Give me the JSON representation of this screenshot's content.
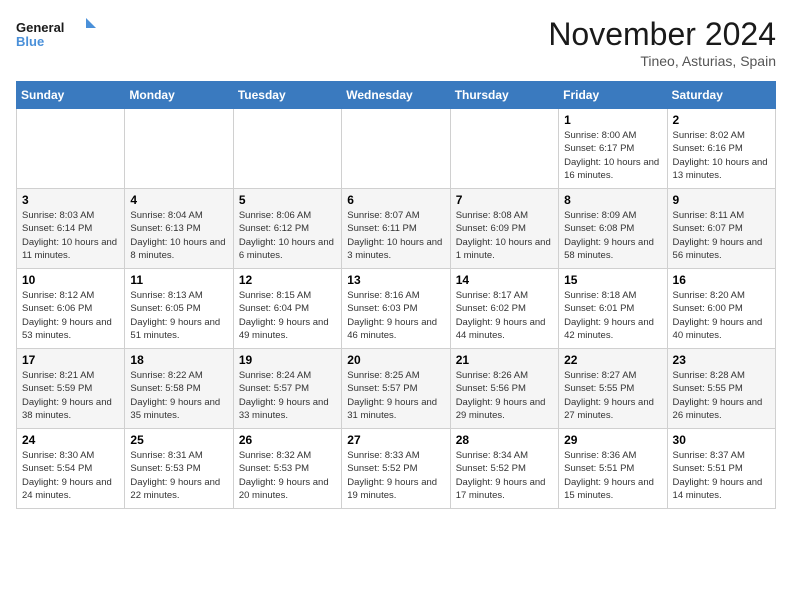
{
  "header": {
    "logo_general": "General",
    "logo_blue": "Blue",
    "month_title": "November 2024",
    "location": "Tineo, Asturias, Spain"
  },
  "days_of_week": [
    "Sunday",
    "Monday",
    "Tuesday",
    "Wednesday",
    "Thursday",
    "Friday",
    "Saturday"
  ],
  "weeks": [
    [
      {
        "day": "",
        "info": ""
      },
      {
        "day": "",
        "info": ""
      },
      {
        "day": "",
        "info": ""
      },
      {
        "day": "",
        "info": ""
      },
      {
        "day": "",
        "info": ""
      },
      {
        "day": "1",
        "info": "Sunrise: 8:00 AM\nSunset: 6:17 PM\nDaylight: 10 hours and 16 minutes."
      },
      {
        "day": "2",
        "info": "Sunrise: 8:02 AM\nSunset: 6:16 PM\nDaylight: 10 hours and 13 minutes."
      }
    ],
    [
      {
        "day": "3",
        "info": "Sunrise: 8:03 AM\nSunset: 6:14 PM\nDaylight: 10 hours and 11 minutes."
      },
      {
        "day": "4",
        "info": "Sunrise: 8:04 AM\nSunset: 6:13 PM\nDaylight: 10 hours and 8 minutes."
      },
      {
        "day": "5",
        "info": "Sunrise: 8:06 AM\nSunset: 6:12 PM\nDaylight: 10 hours and 6 minutes."
      },
      {
        "day": "6",
        "info": "Sunrise: 8:07 AM\nSunset: 6:11 PM\nDaylight: 10 hours and 3 minutes."
      },
      {
        "day": "7",
        "info": "Sunrise: 8:08 AM\nSunset: 6:09 PM\nDaylight: 10 hours and 1 minute."
      },
      {
        "day": "8",
        "info": "Sunrise: 8:09 AM\nSunset: 6:08 PM\nDaylight: 9 hours and 58 minutes."
      },
      {
        "day": "9",
        "info": "Sunrise: 8:11 AM\nSunset: 6:07 PM\nDaylight: 9 hours and 56 minutes."
      }
    ],
    [
      {
        "day": "10",
        "info": "Sunrise: 8:12 AM\nSunset: 6:06 PM\nDaylight: 9 hours and 53 minutes."
      },
      {
        "day": "11",
        "info": "Sunrise: 8:13 AM\nSunset: 6:05 PM\nDaylight: 9 hours and 51 minutes."
      },
      {
        "day": "12",
        "info": "Sunrise: 8:15 AM\nSunset: 6:04 PM\nDaylight: 9 hours and 49 minutes."
      },
      {
        "day": "13",
        "info": "Sunrise: 8:16 AM\nSunset: 6:03 PM\nDaylight: 9 hours and 46 minutes."
      },
      {
        "day": "14",
        "info": "Sunrise: 8:17 AM\nSunset: 6:02 PM\nDaylight: 9 hours and 44 minutes."
      },
      {
        "day": "15",
        "info": "Sunrise: 8:18 AM\nSunset: 6:01 PM\nDaylight: 9 hours and 42 minutes."
      },
      {
        "day": "16",
        "info": "Sunrise: 8:20 AM\nSunset: 6:00 PM\nDaylight: 9 hours and 40 minutes."
      }
    ],
    [
      {
        "day": "17",
        "info": "Sunrise: 8:21 AM\nSunset: 5:59 PM\nDaylight: 9 hours and 38 minutes."
      },
      {
        "day": "18",
        "info": "Sunrise: 8:22 AM\nSunset: 5:58 PM\nDaylight: 9 hours and 35 minutes."
      },
      {
        "day": "19",
        "info": "Sunrise: 8:24 AM\nSunset: 5:57 PM\nDaylight: 9 hours and 33 minutes."
      },
      {
        "day": "20",
        "info": "Sunrise: 8:25 AM\nSunset: 5:57 PM\nDaylight: 9 hours and 31 minutes."
      },
      {
        "day": "21",
        "info": "Sunrise: 8:26 AM\nSunset: 5:56 PM\nDaylight: 9 hours and 29 minutes."
      },
      {
        "day": "22",
        "info": "Sunrise: 8:27 AM\nSunset: 5:55 PM\nDaylight: 9 hours and 27 minutes."
      },
      {
        "day": "23",
        "info": "Sunrise: 8:28 AM\nSunset: 5:55 PM\nDaylight: 9 hours and 26 minutes."
      }
    ],
    [
      {
        "day": "24",
        "info": "Sunrise: 8:30 AM\nSunset: 5:54 PM\nDaylight: 9 hours and 24 minutes."
      },
      {
        "day": "25",
        "info": "Sunrise: 8:31 AM\nSunset: 5:53 PM\nDaylight: 9 hours and 22 minutes."
      },
      {
        "day": "26",
        "info": "Sunrise: 8:32 AM\nSunset: 5:53 PM\nDaylight: 9 hours and 20 minutes."
      },
      {
        "day": "27",
        "info": "Sunrise: 8:33 AM\nSunset: 5:52 PM\nDaylight: 9 hours and 19 minutes."
      },
      {
        "day": "28",
        "info": "Sunrise: 8:34 AM\nSunset: 5:52 PM\nDaylight: 9 hours and 17 minutes."
      },
      {
        "day": "29",
        "info": "Sunrise: 8:36 AM\nSunset: 5:51 PM\nDaylight: 9 hours and 15 minutes."
      },
      {
        "day": "30",
        "info": "Sunrise: 8:37 AM\nSunset: 5:51 PM\nDaylight: 9 hours and 14 minutes."
      }
    ]
  ]
}
